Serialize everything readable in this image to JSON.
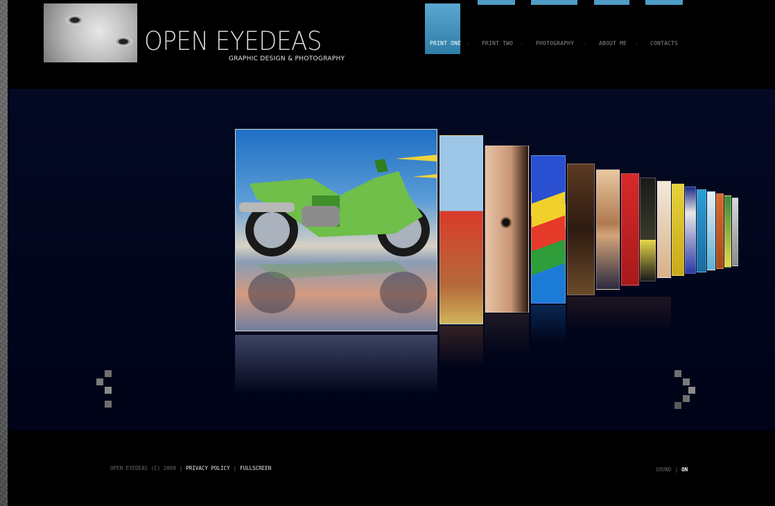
{
  "header": {
    "title": "OPEN EYEDEAS",
    "subtitle": "GRAPHIC DESIGN & PHOTOGRAPHY"
  },
  "nav": {
    "items": [
      {
        "label": "PRINT ONE",
        "active": true
      },
      {
        "label": "PRINT TWO",
        "active": false
      },
      {
        "label": "PHOTOGRAPHY",
        "active": false
      },
      {
        "label": "ABOUT ME",
        "active": false
      },
      {
        "label": "CONTACTS",
        "active": false
      }
    ],
    "separator": ":"
  },
  "gallery": {
    "featured": "green motorcycle artwork",
    "thumbnail_count": 15,
    "prev_icon": "chevron-left-icon",
    "next_icon": "chevron-right-icon"
  },
  "footer": {
    "copyright": "OPEN EYEDEAS (C) 2009",
    "privacy_label": "PRIVACY POLICY",
    "fullscreen_label": "FULLSCREEN",
    "sound_label": "SOUND",
    "sound_value": "ON"
  },
  "colors": {
    "accent": "#3f8fbd",
    "stage_bg": "#020a22",
    "page_bg": "#000000"
  }
}
